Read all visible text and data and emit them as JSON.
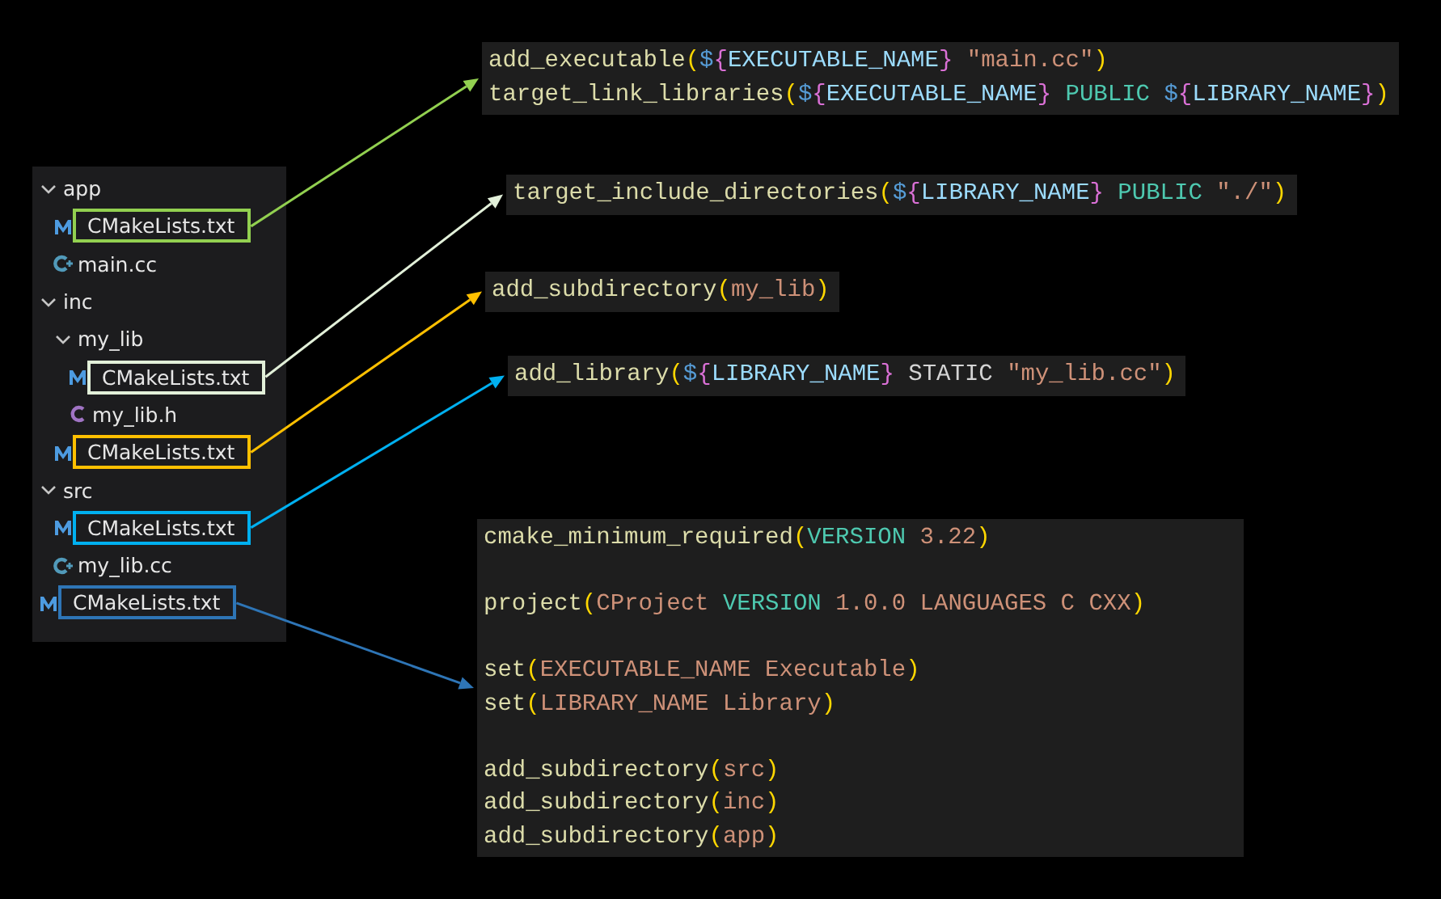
{
  "tree": {
    "items": [
      {
        "label": "app",
        "kind": "folder",
        "expanded": true,
        "children": [
          {
            "label": "CMakeLists.txt",
            "kind": "cmake",
            "color": "#92d050"
          },
          {
            "label": "main.cc",
            "kind": "cpp"
          }
        ]
      },
      {
        "label": "inc",
        "kind": "folder",
        "expanded": true,
        "children": [
          {
            "label": "my_lib",
            "kind": "folder",
            "expanded": true,
            "children": [
              {
                "label": "CMakeLists.txt",
                "kind": "cmake",
                "color": "#e2f0d9"
              },
              {
                "label": "my_lib.h",
                "kind": "c"
              }
            ]
          },
          {
            "label": "CMakeLists.txt",
            "kind": "cmake",
            "color": "#ffc000"
          }
        ]
      },
      {
        "label": "src",
        "kind": "folder",
        "expanded": true,
        "children": [
          {
            "label": "CMakeLists.txt",
            "kind": "cmake",
            "color": "#00b0f0"
          },
          {
            "label": "my_lib.cc",
            "kind": "cpp"
          }
        ]
      },
      {
        "label": "CMakeLists.txt",
        "kind": "cmake",
        "color": "#2e75b6"
      }
    ]
  },
  "snippets": [
    {
      "groups": [
        [
          [
            {
              "kind": "fn",
              "text": "add_executable"
            },
            {
              "kind": "paren",
              "text": "("
            },
            {
              "kind": "dollar",
              "text": "$"
            },
            {
              "kind": "brace",
              "text": "{"
            },
            {
              "kind": "var",
              "text": "EXECUTABLE_NAME"
            },
            {
              "kind": "brace",
              "text": "}"
            },
            {
              "kind": "string",
              "text": " \"main.cc\""
            },
            {
              "kind": "paren",
              "text": ")"
            }
          ],
          [
            {
              "kind": "fn",
              "text": "target_link_libraries"
            },
            {
              "kind": "paren",
              "text": "("
            },
            {
              "kind": "dollar",
              "text": "$"
            },
            {
              "kind": "brace",
              "text": "{"
            },
            {
              "kind": "var",
              "text": "EXECUTABLE_NAME"
            },
            {
              "kind": "brace",
              "text": "}"
            },
            {
              "kind": "keyword",
              "text": " PUBLIC "
            },
            {
              "kind": "dollar",
              "text": "$"
            },
            {
              "kind": "brace",
              "text": "{"
            },
            {
              "kind": "var",
              "text": "LIBRARY_NAME"
            },
            {
              "kind": "brace",
              "text": "}"
            },
            {
              "kind": "paren",
              "text": ")"
            }
          ]
        ]
      ]
    },
    {
      "groups": [
        [
          [
            {
              "kind": "fn",
              "text": "target_include_directories"
            },
            {
              "kind": "paren",
              "text": "("
            },
            {
              "kind": "dollar",
              "text": "$"
            },
            {
              "kind": "brace",
              "text": "{"
            },
            {
              "kind": "var",
              "text": "LIBRARY_NAME"
            },
            {
              "kind": "brace",
              "text": "}"
            },
            {
              "kind": "keyword",
              "text": " PUBLIC "
            },
            {
              "kind": "string",
              "text": "\"./\""
            },
            {
              "kind": "paren",
              "text": ")"
            }
          ]
        ]
      ]
    },
    {
      "groups": [
        [
          [
            {
              "kind": "fn",
              "text": "add_subdirectory"
            },
            {
              "kind": "paren",
              "text": "("
            },
            {
              "kind": "arg",
              "text": "my_lib"
            },
            {
              "kind": "paren",
              "text": ")"
            }
          ]
        ]
      ]
    },
    {
      "groups": [
        [
          [
            {
              "kind": "fn",
              "text": "add_library"
            },
            {
              "kind": "paren",
              "text": "("
            },
            {
              "kind": "dollar",
              "text": "$"
            },
            {
              "kind": "brace",
              "text": "{"
            },
            {
              "kind": "var",
              "text": "LIBRARY_NAME"
            },
            {
              "kind": "brace",
              "text": "}"
            },
            {
              "kind": "plain",
              "text": " STATIC "
            },
            {
              "kind": "string",
              "text": "\"my_lib.cc\""
            },
            {
              "kind": "paren",
              "text": ")"
            }
          ]
        ]
      ]
    },
    {
      "groups": [
        [
          [
            {
              "kind": "fn",
              "text": "cmake_minimum_required"
            },
            {
              "kind": "paren",
              "text": "("
            },
            {
              "kind": "keyword",
              "text": "VERSION"
            },
            {
              "kind": "arg",
              "text": " 3.22"
            },
            {
              "kind": "paren",
              "text": ")"
            }
          ]
        ],
        [
          [
            {
              "kind": "fn",
              "text": "project"
            },
            {
              "kind": "paren",
              "text": "("
            },
            {
              "kind": "arg",
              "text": "CProject "
            },
            {
              "kind": "keyword",
              "text": "VERSION"
            },
            {
              "kind": "arg",
              "text": " 1.0.0 LANGUAGES C CXX"
            },
            {
              "kind": "paren",
              "text": ")"
            }
          ]
        ],
        [
          [
            {
              "kind": "fn",
              "text": "set"
            },
            {
              "kind": "paren",
              "text": "("
            },
            {
              "kind": "arg",
              "text": "EXECUTABLE_NAME Executable"
            },
            {
              "kind": "paren",
              "text": ")"
            }
          ],
          [
            {
              "kind": "fn",
              "text": "set"
            },
            {
              "kind": "paren",
              "text": "("
            },
            {
              "kind": "arg",
              "text": "LIBRARY_NAME Library"
            },
            {
              "kind": "paren",
              "text": ")"
            }
          ]
        ],
        [
          [
            {
              "kind": "fn",
              "text": "add_subdirectory"
            },
            {
              "kind": "paren",
              "text": "("
            },
            {
              "kind": "arg",
              "text": "src"
            },
            {
              "kind": "paren",
              "text": ")"
            }
          ],
          [
            {
              "kind": "fn",
              "text": "add_subdirectory"
            },
            {
              "kind": "paren",
              "text": "("
            },
            {
              "kind": "arg",
              "text": "inc"
            },
            {
              "kind": "paren",
              "text": ")"
            }
          ],
          [
            {
              "kind": "fn",
              "text": "add_subdirectory"
            },
            {
              "kind": "paren",
              "text": "("
            },
            {
              "kind": "arg",
              "text": "app"
            },
            {
              "kind": "paren",
              "text": ")"
            }
          ]
        ]
      ]
    }
  ]
}
